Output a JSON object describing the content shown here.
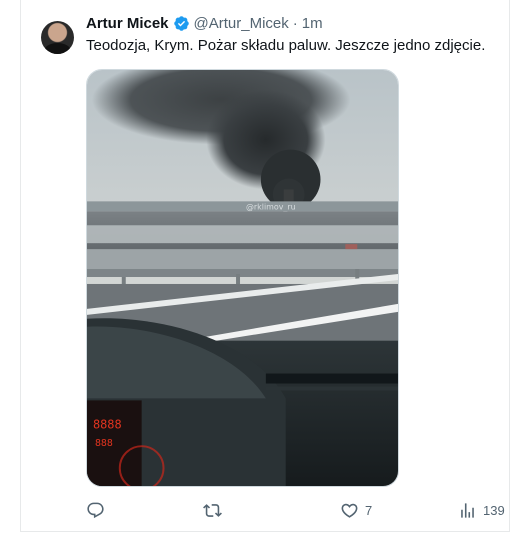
{
  "tweet": {
    "author_name": "Artur Micek",
    "handle": "@Artur_Micek",
    "separator": "·",
    "time": "1m",
    "text": "Teodozja, Krym. Pożar składu paluw. Jeszcze jedno zdjęcie.",
    "media_watermark": "@rklimov_ru"
  },
  "actions": {
    "reply_count": "",
    "retweet_count": "",
    "like_count": "7",
    "views_count": "139"
  },
  "icons": {
    "verified": "verified-badge-icon",
    "reply": "reply-icon",
    "retweet": "retweet-icon",
    "like": "heart-icon",
    "views": "views-bar-icon"
  },
  "colors": {
    "verified": "#1d9bf0",
    "text": "#0f1419",
    "secondary": "#536471",
    "border": "#e7e9ea"
  }
}
